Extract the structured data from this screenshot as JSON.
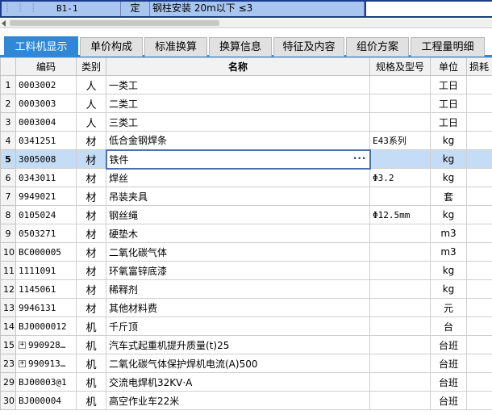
{
  "top_row": {
    "code": "B1-1",
    "type": "定",
    "name": "钢柱安装 20m以下 ≤3"
  },
  "tabs": [
    {
      "label": "工料机显示",
      "active": true
    },
    {
      "label": "单价构成",
      "active": false
    },
    {
      "label": "标准换算",
      "active": false
    },
    {
      "label": "换算信息",
      "active": false
    },
    {
      "label": "特征及内容",
      "active": false
    },
    {
      "label": "组价方案",
      "active": false
    },
    {
      "label": "工程量明细",
      "active": false
    }
  ],
  "columns": {
    "code": "编码",
    "type": "类别",
    "name": "名称",
    "spec": "规格及型号",
    "unit": "单位",
    "loss": "损耗"
  },
  "rows": [
    {
      "num": "1",
      "code": "0003002",
      "type": "人",
      "name": "一类工",
      "spec": "",
      "unit": "工日",
      "expand": false,
      "selected": false
    },
    {
      "num": "2",
      "code": "0003003",
      "type": "人",
      "name": "二类工",
      "spec": "",
      "unit": "工日",
      "expand": false,
      "selected": false
    },
    {
      "num": "3",
      "code": "0003004",
      "type": "人",
      "name": "三类工",
      "spec": "",
      "unit": "工日",
      "expand": false,
      "selected": false
    },
    {
      "num": "4",
      "code": "0341251",
      "type": "材",
      "name": "低合金钢焊条",
      "spec": "E43系列",
      "unit": "kg",
      "expand": false,
      "selected": false
    },
    {
      "num": "5",
      "code": "3005008",
      "type": "材",
      "name": "铁件",
      "spec": "",
      "unit": "kg",
      "expand": false,
      "selected": true
    },
    {
      "num": "6",
      "code": "0343011",
      "type": "材",
      "name": "焊丝",
      "spec": "Φ3.2",
      "unit": "kg",
      "expand": false,
      "selected": false
    },
    {
      "num": "7",
      "code": "9949021",
      "type": "材",
      "name": "吊装夹具",
      "spec": "",
      "unit": "套",
      "expand": false,
      "selected": false
    },
    {
      "num": "8",
      "code": "0105024",
      "type": "材",
      "name": "钢丝绳",
      "spec": "Φ12.5mm",
      "unit": "kg",
      "expand": false,
      "selected": false
    },
    {
      "num": "9",
      "code": "0503271",
      "type": "材",
      "name": "硬垫木",
      "spec": "",
      "unit": "m3",
      "expand": false,
      "selected": false
    },
    {
      "num": "10",
      "code": "BC000005",
      "type": "材",
      "name": "二氧化碳气体",
      "spec": "",
      "unit": "m3",
      "expand": false,
      "selected": false
    },
    {
      "num": "11",
      "code": "1111091",
      "type": "材",
      "name": "环氧富锌底漆",
      "spec": "",
      "unit": "kg",
      "expand": false,
      "selected": false
    },
    {
      "num": "12",
      "code": "1145061",
      "type": "材",
      "name": "稀释剂",
      "spec": "",
      "unit": "kg",
      "expand": false,
      "selected": false
    },
    {
      "num": "13",
      "code": "9946131",
      "type": "材",
      "name": "其他材料费",
      "spec": "",
      "unit": "元",
      "expand": false,
      "selected": false
    },
    {
      "num": "14",
      "code": "BJ0000012",
      "type": "机",
      "name": "千斤顶",
      "spec": "",
      "unit": "台",
      "expand": false,
      "selected": false
    },
    {
      "num": "15",
      "code": "990928…",
      "type": "机",
      "name": "汽车式起重机提升质量(t)25",
      "spec": "",
      "unit": "台班",
      "expand": true,
      "selected": false
    },
    {
      "num": "23",
      "code": "990913…",
      "type": "机",
      "name": "二氧化碳气体保护焊机电流(A)500",
      "spec": "",
      "unit": "台班",
      "expand": true,
      "selected": false
    },
    {
      "num": "29",
      "code": "BJ00003@1",
      "type": "机",
      "name": "交流电焊机32KV·A",
      "spec": "",
      "unit": "台班",
      "expand": false,
      "selected": false
    },
    {
      "num": "30",
      "code": "BJ000004",
      "type": "机",
      "name": "高空作业车22米",
      "spec": "",
      "unit": "台班",
      "expand": false,
      "selected": false
    }
  ]
}
